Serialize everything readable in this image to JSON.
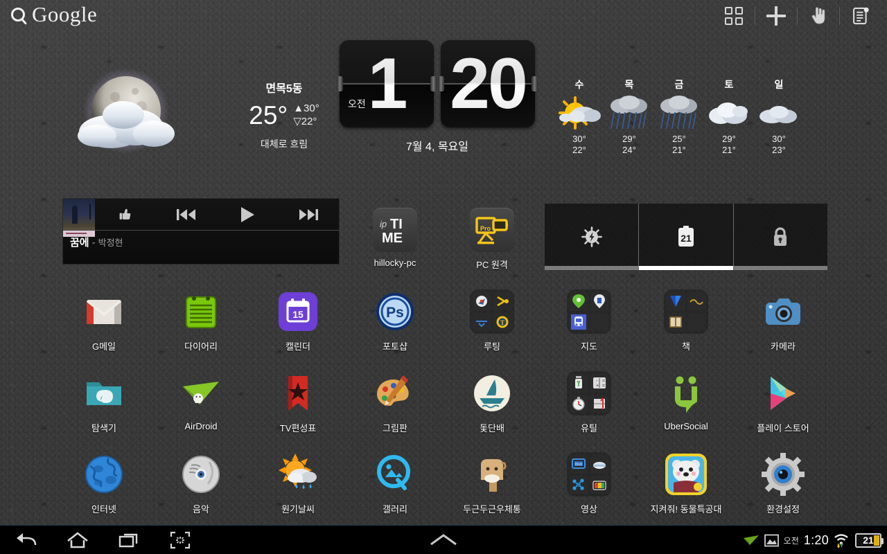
{
  "topbar": {
    "search_label": "Google",
    "search_icon": "search-icon",
    "actions": [
      {
        "name": "apps-grid-button",
        "icon": "apps-grid-icon"
      },
      {
        "name": "add-widget-button",
        "icon": "plus-icon"
      },
      {
        "name": "touch-pointer-button",
        "icon": "hand-pointer-icon"
      },
      {
        "name": "notes-list-button",
        "icon": "list-document-icon"
      }
    ]
  },
  "weather": {
    "city": "면목5동",
    "temp": "25°",
    "high": "▲30°",
    "low": "▽22°",
    "condition": "대체로 흐림",
    "icon": "moon-behind-cloud-icon"
  },
  "clock": {
    "hour": "1",
    "minute": "20",
    "ampm": "오전",
    "date": "7월 4, 목요일"
  },
  "forecast": [
    {
      "day": "수",
      "icon": "sun-behind-cloud-icon",
      "high": "30°",
      "low": "22°"
    },
    {
      "day": "목",
      "icon": "rain-icon",
      "high": "29°",
      "low": "24°"
    },
    {
      "day": "금",
      "icon": "rain-icon",
      "high": "25°",
      "low": "21°"
    },
    {
      "day": "토",
      "icon": "cloud-icon",
      "high": "29°",
      "low": "21°"
    },
    {
      "day": "일",
      "icon": "cloud-icon",
      "high": "30°",
      "low": "23°"
    }
  ],
  "music": {
    "title": "꿈에",
    "dash": "-",
    "artist": "박정현",
    "controls": [
      {
        "name": "thumbs-up-button",
        "icon": "thumbs-up-icon"
      },
      {
        "name": "previous-track-button",
        "icon": "previous-icon"
      },
      {
        "name": "play-button",
        "icon": "play-icon"
      },
      {
        "name": "next-track-button",
        "icon": "next-icon"
      }
    ]
  },
  "shortcuts_top": [
    {
      "name": "shortcut-hillocky-pc",
      "label": "hillocky-pc",
      "icon": "iptime-icon"
    },
    {
      "name": "shortcut-pc-remote",
      "label": "PC 원격",
      "icon": "remote-pc-pro-icon"
    }
  ],
  "control_widget": {
    "panels": [
      {
        "name": "brightness-panel",
        "icon": "brightness-sun-icon",
        "active": false
      },
      {
        "name": "battery-panel",
        "icon": "battery-clipboard-icon",
        "value": "21",
        "active": true
      },
      {
        "name": "lock-panel",
        "icon": "lock-icon",
        "active": false
      }
    ]
  },
  "apps": [
    {
      "name": "app-gmail",
      "label": "G메일",
      "icon": "gmail-icon",
      "row": 0,
      "col": 0
    },
    {
      "name": "app-diary",
      "label": "다이어리",
      "icon": "diary-notepad-icon",
      "row": 0,
      "col": 1
    },
    {
      "name": "app-calendar",
      "label": "캘린더",
      "icon": "calendar-icon",
      "row": 0,
      "col": 2,
      "badge": "15"
    },
    {
      "name": "app-photoshop",
      "label": "포토샵",
      "icon": "photoshop-ps-icon",
      "row": 0,
      "col": 3,
      "badge": "Ps"
    },
    {
      "name": "folder-rooting",
      "label": "루팅",
      "icon": "folder-icon",
      "row": 0,
      "col": 4
    },
    {
      "name": "folder-maps",
      "label": "지도",
      "icon": "folder-icon",
      "row": 0,
      "col": 5
    },
    {
      "name": "folder-books",
      "label": "책",
      "icon": "folder-icon",
      "row": 0,
      "col": 6
    },
    {
      "name": "app-camera",
      "label": "카메라",
      "icon": "camera-icon",
      "row": 0,
      "col": 7
    },
    {
      "name": "app-explorer",
      "label": "탐색기",
      "icon": "file-explorer-folder-icon",
      "row": 1,
      "col": 0
    },
    {
      "name": "app-airdroid",
      "label": "AirDroid",
      "icon": "airdroid-paperplane-icon",
      "row": 1,
      "col": 1
    },
    {
      "name": "app-tv-schedule",
      "label": "TV편성표",
      "icon": "red-bookmark-star-icon",
      "row": 1,
      "col": 2
    },
    {
      "name": "app-paint",
      "label": "그림판",
      "icon": "palette-icon",
      "row": 1,
      "col": 3
    },
    {
      "name": "app-sailboat",
      "label": "돛단배",
      "icon": "sailboat-icon",
      "row": 1,
      "col": 4
    },
    {
      "name": "folder-utilities",
      "label": "유틸",
      "icon": "folder-icon",
      "row": 1,
      "col": 5
    },
    {
      "name": "app-ubersocial",
      "label": "UberSocial",
      "icon": "ubersocial-icon",
      "row": 1,
      "col": 6
    },
    {
      "name": "app-play-store",
      "label": "플레이 스토어",
      "icon": "play-store-icon",
      "row": 1,
      "col": 7
    },
    {
      "name": "app-internet",
      "label": "인터넷",
      "icon": "globe-icon",
      "row": 2,
      "col": 0
    },
    {
      "name": "app-music",
      "label": "음악",
      "icon": "music-disc-icon",
      "row": 2,
      "col": 1
    },
    {
      "name": "app-weather",
      "label": "원기날씨",
      "icon": "sun-rain-icon",
      "row": 2,
      "col": 2
    },
    {
      "name": "app-gallery",
      "label": "갤러리",
      "icon": "gallery-q-icon",
      "row": 2,
      "col": 3
    },
    {
      "name": "app-mailbox",
      "label": "두근두근우체통",
      "icon": "mailbox-icon",
      "row": 2,
      "col": 4
    },
    {
      "name": "folder-video",
      "label": "영상",
      "icon": "folder-icon",
      "row": 2,
      "col": 5
    },
    {
      "name": "app-animal-squad",
      "label": "지켜줘! 동물특공대",
      "icon": "bear-game-icon",
      "row": 2,
      "col": 6
    },
    {
      "name": "app-settings",
      "label": "환경설정",
      "icon": "settings-gear-icon",
      "row": 2,
      "col": 7
    }
  ],
  "systembar": {
    "nav": [
      {
        "name": "back-button",
        "icon": "back-arrow-icon"
      },
      {
        "name": "home-button",
        "icon": "home-icon"
      },
      {
        "name": "recents-button",
        "icon": "recent-apps-icon"
      },
      {
        "name": "screenshot-button",
        "icon": "screenshot-capture-icon"
      }
    ],
    "home-indicator": "chevron-up-icon",
    "status": {
      "airdroid_icon": "paperplane-icon",
      "screenshot_icon": "image-icon",
      "ampm": "오전",
      "time": "1:20",
      "wifi_icon": "wifi-icon",
      "battery_level": "21"
    }
  },
  "colors": {
    "wallpaper": "#3a3a3a",
    "accent": "#ffffff",
    "battery_fill": "#e2b007",
    "systembar": "#000000"
  }
}
